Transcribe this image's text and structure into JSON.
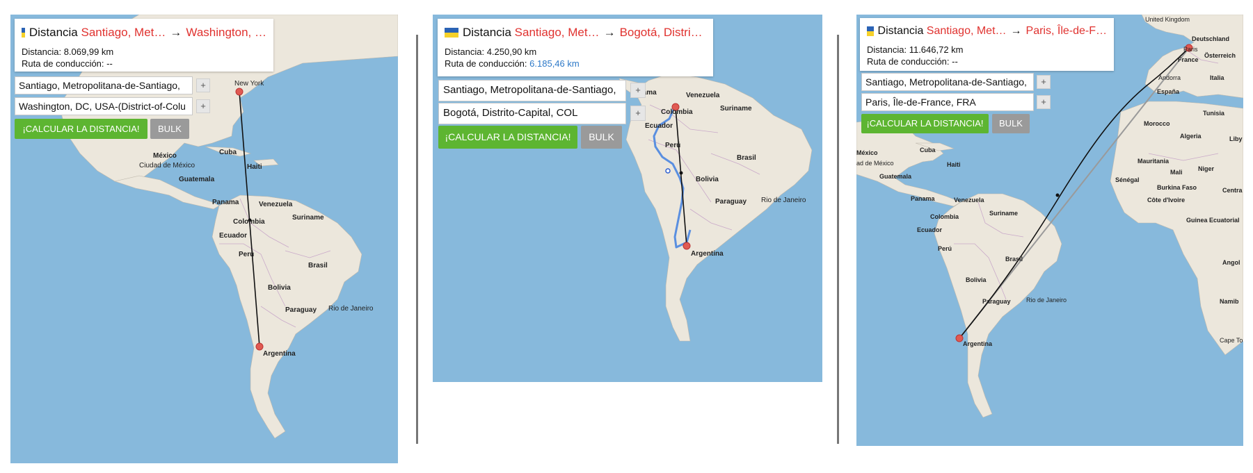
{
  "panels": [
    {
      "title_label": "Distancia",
      "origin": "Santiago, Met…",
      "destination": "Washington, …",
      "distance_label": "Distancia:",
      "distance_value": "8.069,99 km",
      "route_label": "Ruta de conducción:",
      "route_value": "--",
      "input_origin": "Santiago, Metropolitana-de-Santiago,",
      "input_destination": "Washington, DC, USA-(District-of-Colu",
      "plus_label": "+",
      "calc_button": "¡CALCULAR LA DISTANCIA!",
      "bulk_button": "BULK",
      "map_labels": {
        "new_york": "New York",
        "mexico": "México",
        "ciudad_mexico": "Ciudad de México",
        "cuba": "Cuba",
        "haiti": "Haiti",
        "guatemala": "Guatemala",
        "panama": "Panama",
        "venezuela": "Venezuela",
        "colombia": "Colombia",
        "suriname": "Suriname",
        "ecuador": "Ecuador",
        "peru": "Perú",
        "brasil": "Brasil",
        "bolivia": "Bolivia",
        "paraguay": "Paraguay",
        "rio": "Rio de Janeiro",
        "argentina": "Argentina"
      }
    },
    {
      "title_label": "Distancia",
      "origin": "Santiago, Met…",
      "destination": "Bogotá, Distri…",
      "distance_label": "Distancia:",
      "distance_value": "4.250,90 km",
      "route_label": "Ruta de conducción:",
      "route_value": "6.185,46 km",
      "input_origin": "Santiago, Metropolitana-de-Santiago,",
      "input_destination": "Bogotá, Distrito-Capital, COL",
      "plus_label": "+",
      "calc_button": "¡CALCULAR LA DISTANCIA!",
      "bulk_button": "BULK",
      "map_labels": {
        "panama": "anama",
        "venezuela": "Venezuela",
        "colombia": "Colombia",
        "suriname": "Suriname",
        "ecuador": "Ecuador",
        "peru": "Perú",
        "brasil": "Brasil",
        "bolivia": "Bolivia",
        "paraguay": "Paraguay",
        "rio": "Rio de Janeiro",
        "argentina": "Argentina"
      }
    },
    {
      "title_label": "Distancia",
      "origin": "Santiago, Met…",
      "destination": "Paris, Île-de-F…",
      "distance_label": "Distancia:",
      "distance_value": "11.646,72 km",
      "route_label": "Ruta de conducción:",
      "route_value": "--",
      "input_origin": "Santiago, Metropolitana-de-Santiago,",
      "input_destination": "Paris, Île-de-France, FRA",
      "plus_label": "+",
      "calc_button": "¡CALCULAR LA DISTANCIA!",
      "bulk_button": "BULK",
      "map_labels": {
        "uk": "United Kingdom",
        "deutschland": "Deutschland",
        "paris": "Paris",
        "france": "France",
        "osterreich": "Österreich",
        "andorra": "Andorra",
        "italia": "Italia",
        "espana": "España",
        "morocco": "Morocco",
        "tunisia": "Tunisia",
        "algeria": "Algeria",
        "libya": "Liby",
        "mauritania": "Mauritania",
        "mali": "Mali",
        "niger": "Niger",
        "senegal": "Sénégal",
        "burkina": "Burkina Faso",
        "central": "Centra",
        "cote": "Côte d'Ivoire",
        "guinea": "Guinea Ecuatorial",
        "angola": "Angol",
        "namibia": "Namib",
        "capetown": "Cape To",
        "mexico": "México",
        "ciudad_mexico": "ad de México",
        "cuba": "Cuba",
        "haiti": "Haiti",
        "guatemala": "Guatemala",
        "panama": "Panama",
        "venezuela": "Venezuela",
        "colombia": "Colombia",
        "suriname": "Suriname",
        "ecuador": "Ecuador",
        "peru": "Perú",
        "brasil": "Brasil",
        "bolivia": "Bolivia",
        "paraguay": "Paraguay",
        "rio": "Rio de Janeiro",
        "argentina": "Argentina"
      }
    }
  ]
}
